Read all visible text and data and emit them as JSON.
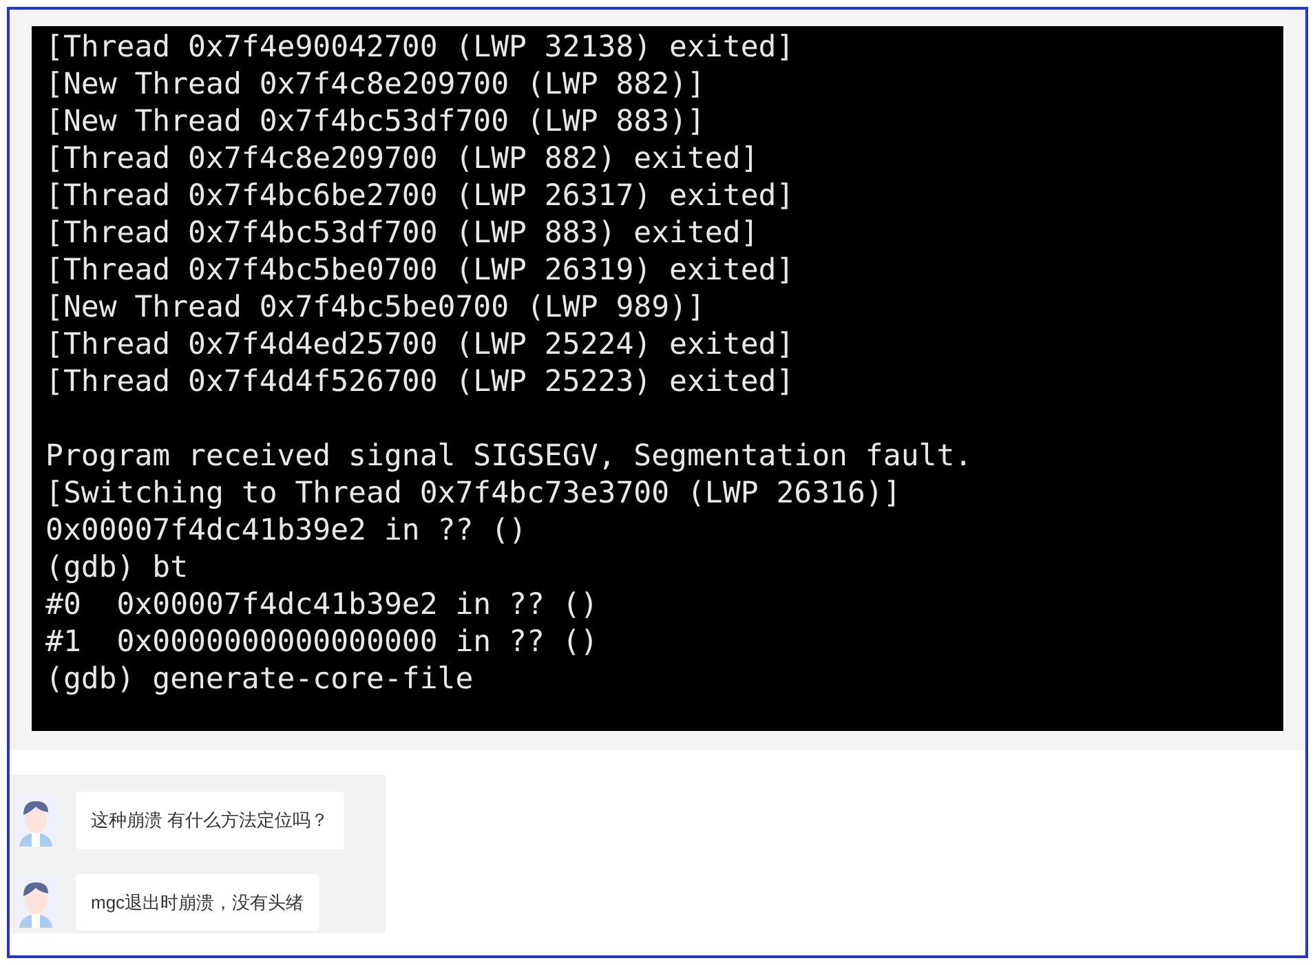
{
  "terminal": {
    "blocks": [
      [
        "[Thread 0x7f4e90042700 (LWP 32138) exited]",
        "[New Thread 0x7f4c8e209700 (LWP 882)]",
        "[New Thread 0x7f4bc53df700 (LWP 883)]",
        "[Thread 0x7f4c8e209700 (LWP 882) exited]",
        "[Thread 0x7f4bc6be2700 (LWP 26317) exited]",
        "[Thread 0x7f4bc53df700 (LWP 883) exited]",
        "[Thread 0x7f4bc5be0700 (LWP 26319) exited]",
        "[New Thread 0x7f4bc5be0700 (LWP 989)]",
        "[Thread 0x7f4d4ed25700 (LWP 25224) exited]",
        "[Thread 0x7f4d4f526700 (LWP 25223) exited]"
      ],
      [
        "Program received signal SIGSEGV, Segmentation fault.",
        "[Switching to Thread 0x7f4bc73e3700 (LWP 26316)]",
        "0x00007f4dc41b39e2 in ?? ()",
        "(gdb) bt",
        "#0  0x00007f4dc41b39e2 in ?? ()",
        "#1  0x0000000000000000 in ?? ()",
        "(gdb) generate-core-file"
      ]
    ]
  },
  "messages": [
    {
      "text": "这种崩溃 有什么方法定位吗？"
    },
    {
      "text": "mgc退出时崩溃，没有头绪"
    }
  ]
}
